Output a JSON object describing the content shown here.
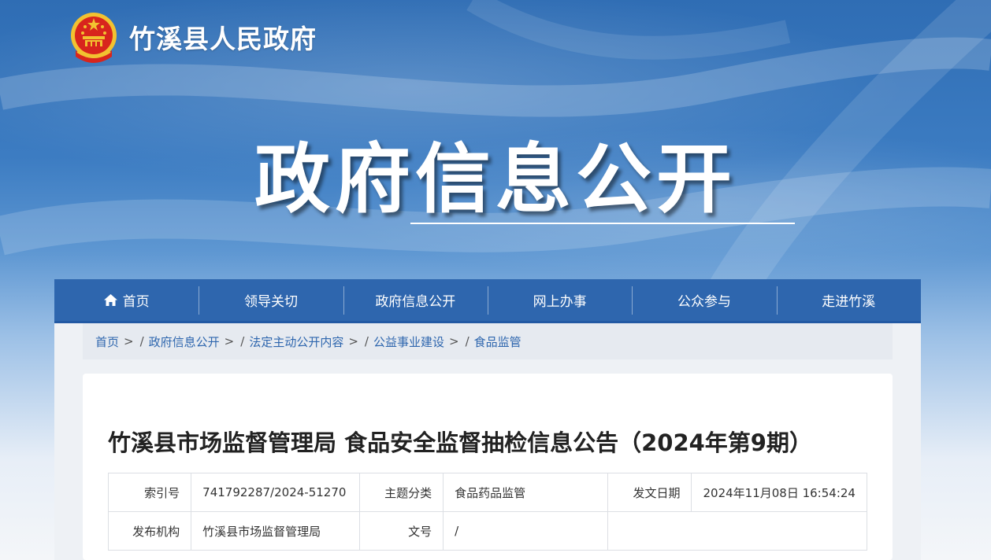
{
  "site": {
    "name": "竹溪县人民政府"
  },
  "hero": {
    "title": "政府信息公开"
  },
  "nav": {
    "items": [
      {
        "label": "首页",
        "icon": "home-icon"
      },
      {
        "label": "领导关切"
      },
      {
        "label": "政府信息公开"
      },
      {
        "label": "网上办事"
      },
      {
        "label": "公众参与"
      },
      {
        "label": "走进竹溪"
      }
    ]
  },
  "breadcrumb": {
    "items": [
      "首页",
      "政府信息公开",
      "法定主动公开内容",
      "公益事业建设",
      "食品监管"
    ],
    "separator": ">",
    "slash": "/"
  },
  "article": {
    "title": "竹溪县市场监督管理局 食品安全监督抽检信息公告（2024年第9期）",
    "meta": {
      "index_label": "索引号",
      "index_value": "741792287/2024-51270",
      "topic_label": "主题分类",
      "topic_value": "食品药品监管",
      "date_label": "发文日期",
      "date_value": "2024年11月08日 16:54:24",
      "publisher_label": "发布机构",
      "publisher_value": "竹溪县市场监督管理局",
      "docno_label": "文号",
      "docno_value": "/"
    }
  },
  "colors": {
    "nav_bg": "#2e66ae",
    "link": "#2e66ae",
    "banner_top": "#2f6db4"
  }
}
